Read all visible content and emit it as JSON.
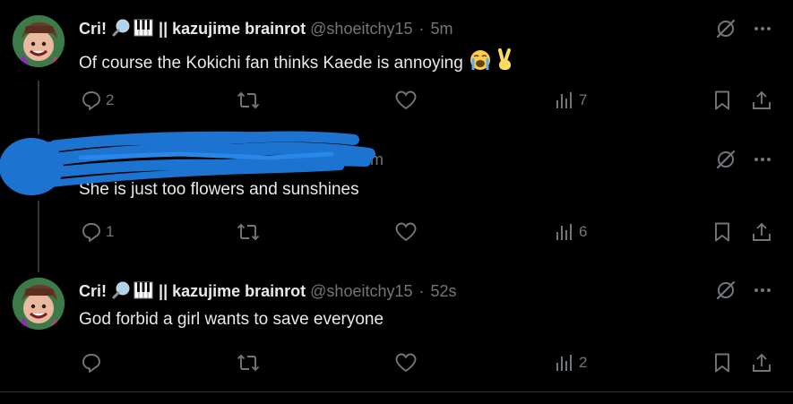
{
  "tweets": [
    {
      "author": "Cri!",
      "name_suffix": "|| kazujime brainrot",
      "handle": "@shoeitchy15",
      "time": "5m",
      "text": "Of course the Kokichi fan thinks Kaede is annoying",
      "text_emojis": [
        "loudly-crying-face-emoji",
        "victory-hand-emoji"
      ],
      "replies": "2",
      "views": "7"
    },
    {
      "time": "5m",
      "text": "She is just too flowers and sunshines",
      "replies": "1",
      "views": "6"
    },
    {
      "author": "Cri!",
      "name_suffix": "|| kazujime brainrot",
      "handle": "@shoeitchy15",
      "time": "52s",
      "text": "God forbid a girl wants to save everyone",
      "replies": "",
      "views": "2"
    }
  ],
  "name_emojis": [
    "magnifying-glass-emoji",
    "piano-keys-emoji"
  ],
  "separator": "·",
  "colors": {
    "background": "#000000",
    "text": "#e7e9ea",
    "muted": "#71767b",
    "redaction": "#1d74d0"
  }
}
